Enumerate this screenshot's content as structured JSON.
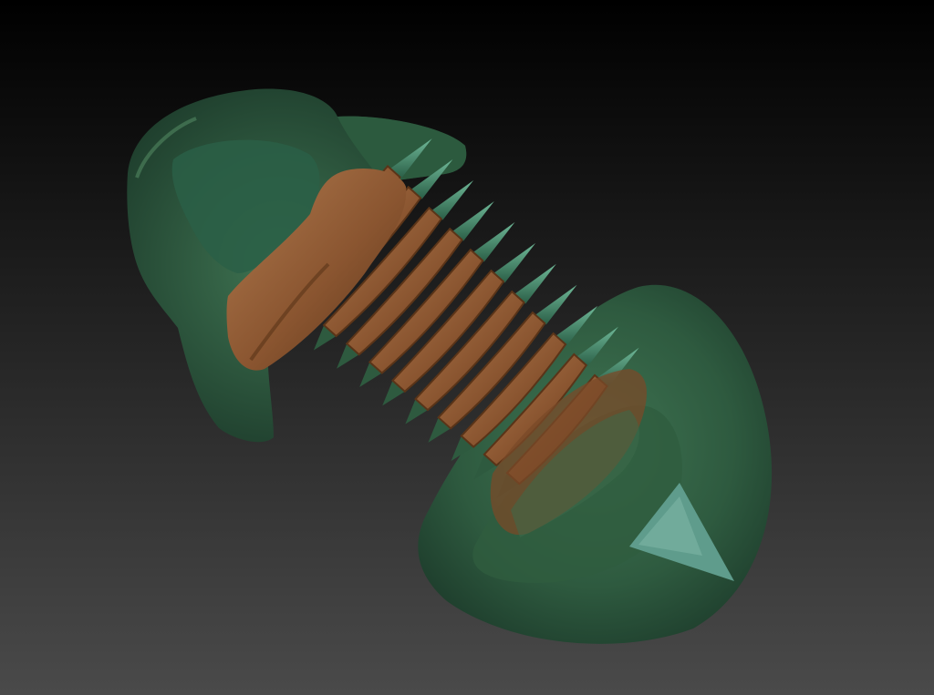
{
  "scene": {
    "subject": "trilobite-sculpt",
    "background": {
      "top": "#000000",
      "bottom": "#4a4a4a"
    },
    "colors": {
      "shell_dark": "#1c3a2a",
      "shell_mid": "#2e5a3f",
      "shell_light": "#3f7452",
      "segment_dark": "#5a3418",
      "segment_mid": "#8a5530",
      "segment_light": "#b07a4e",
      "leg_dark": "#2a5e46",
      "leg_light": "#6fb898",
      "tail_spike": "#5f9c8c"
    }
  }
}
